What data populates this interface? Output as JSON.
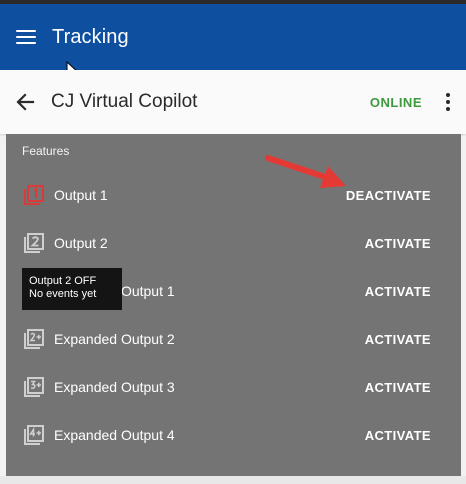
{
  "app": {
    "title": "Tracking",
    "menu_icon": "hamburger-menu-icon"
  },
  "header": {
    "title": "CJ Virtual Copilot",
    "status": "ONLINE",
    "status_color": "#3d9a3d"
  },
  "features": {
    "section_label": "Features",
    "items": [
      {
        "label": "Output 1",
        "action": "DEACTIVATE",
        "icon": "output-1-icon",
        "active": true
      },
      {
        "label": "Output 2",
        "action": "ACTIVATE",
        "icon": "output-2-icon",
        "active": false
      },
      {
        "label": "Expanded Output 1",
        "action": "ACTIVATE",
        "icon": "expanded-output-1-icon",
        "active": false
      },
      {
        "label": "Expanded Output 2",
        "action": "ACTIVATE",
        "icon": "expanded-output-2-icon",
        "active": false
      },
      {
        "label": "Expanded Output 3",
        "action": "ACTIVATE",
        "icon": "expanded-output-3-icon",
        "active": false
      },
      {
        "label": "Expanded Output 4",
        "action": "ACTIVATE",
        "icon": "expanded-output-4-icon",
        "active": false
      }
    ]
  },
  "tooltip": {
    "line1": "Output 2 OFF",
    "line2": "No events yet"
  },
  "colors": {
    "appbar": "#0f4f9f",
    "active_icon": "#d93a3a",
    "arrow": "#e53935",
    "panel": "#747474"
  }
}
